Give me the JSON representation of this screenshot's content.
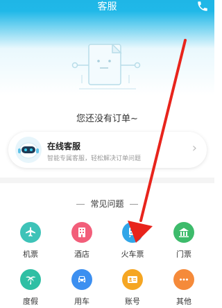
{
  "header": {
    "title": "客服"
  },
  "empty": {
    "text": "您还没有订单~"
  },
  "online_service": {
    "title": "在线客服",
    "subtitle": "智能专属客服，轻松解决订单问题"
  },
  "faq": {
    "title": "常见问题",
    "items": [
      {
        "label": "机票",
        "icon": "plane-icon",
        "color": "#3ec3b8"
      },
      {
        "label": "酒店",
        "icon": "hotel-icon",
        "color": "#f25e7a"
      },
      {
        "label": "火车票",
        "icon": "train-icon",
        "color": "#31a6e8"
      },
      {
        "label": "门票",
        "icon": "ticket-icon",
        "color": "#3dbb6b"
      },
      {
        "label": "度假",
        "icon": "palm-tree-icon",
        "color": "#2fbfa4"
      },
      {
        "label": "用车",
        "icon": "car-icon",
        "color": "#3c8ff0"
      },
      {
        "label": "账号",
        "icon": "account-card-icon",
        "color": "#f5a623"
      },
      {
        "label": "其他",
        "icon": "more-dots-icon",
        "color": "#f58a3a"
      }
    ]
  },
  "colors": {
    "header": "#20b8e8",
    "annotation_arrow": "#e8241c"
  }
}
